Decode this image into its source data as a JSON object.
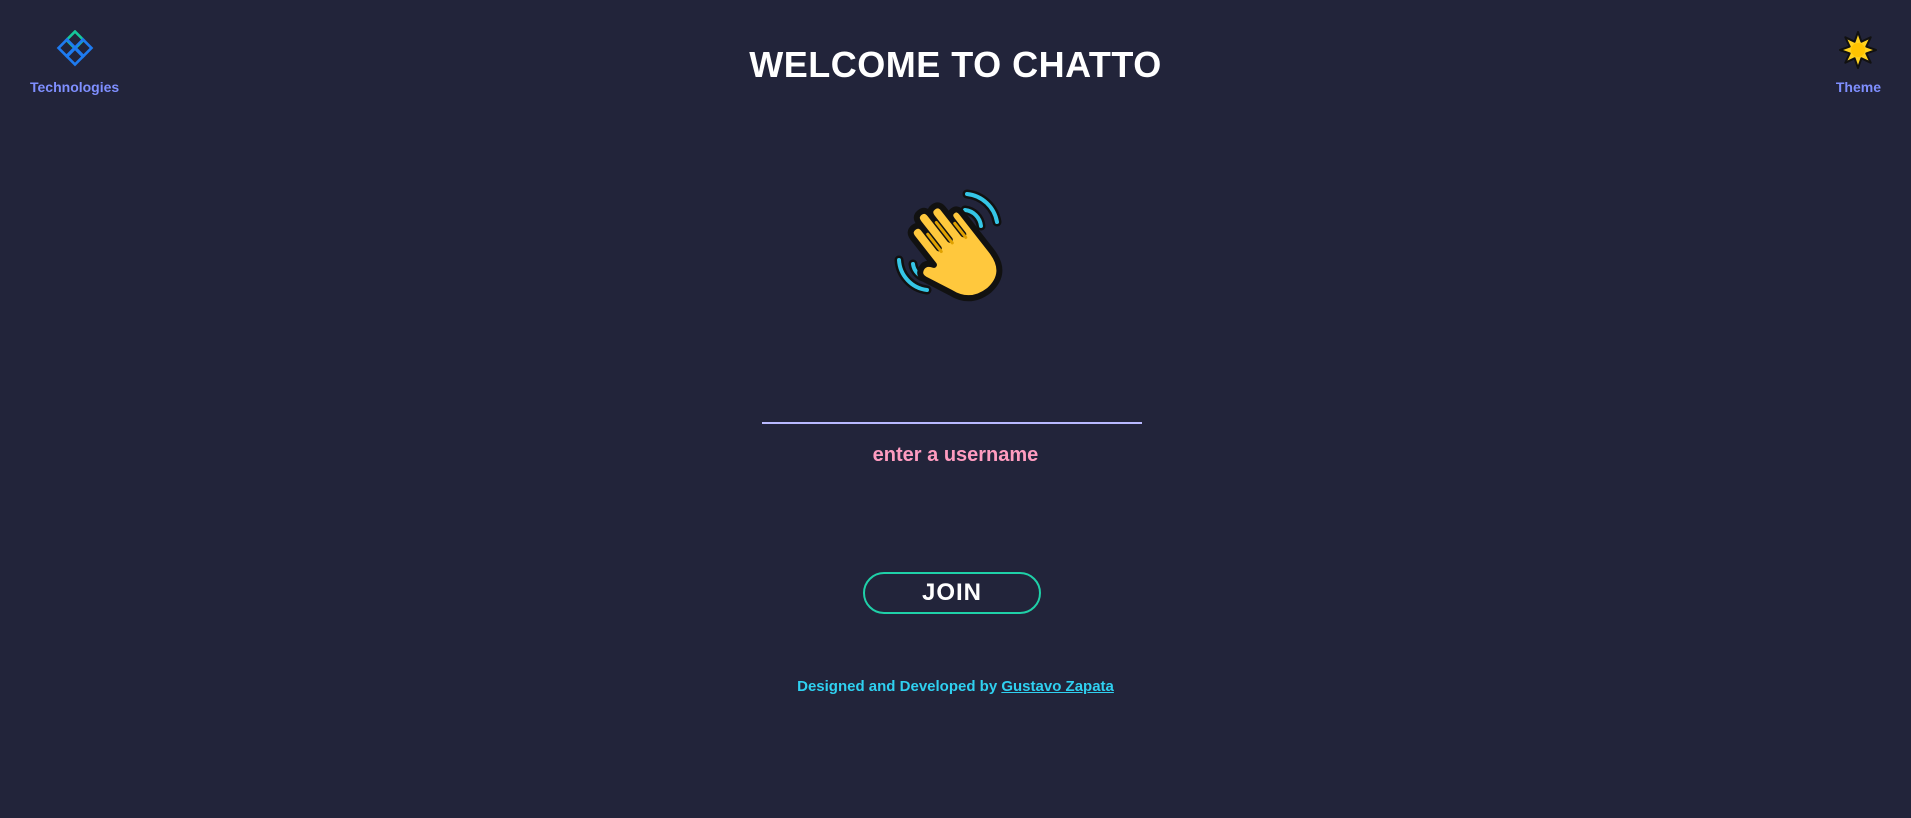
{
  "nav": {
    "technologies_label": "Technologies",
    "theme_label": "Theme"
  },
  "header": {
    "title": "WELCOME TO CHATTO"
  },
  "form": {
    "username_value": "",
    "hint": "enter a username",
    "join_label": "JOIN"
  },
  "footer": {
    "prefix": "Designed and Developed by ",
    "author": "Gustavo Zapata"
  },
  "icons": {
    "technologies": "diamond-grid-icon",
    "theme": "sun-icon",
    "hero": "waving-hand-icon"
  },
  "colors": {
    "background": "#22243a",
    "nav_label": "#7f8fff",
    "hint": "#ff9cc0",
    "join_border": "#1fd0a8",
    "footer": "#2fd0f0"
  }
}
